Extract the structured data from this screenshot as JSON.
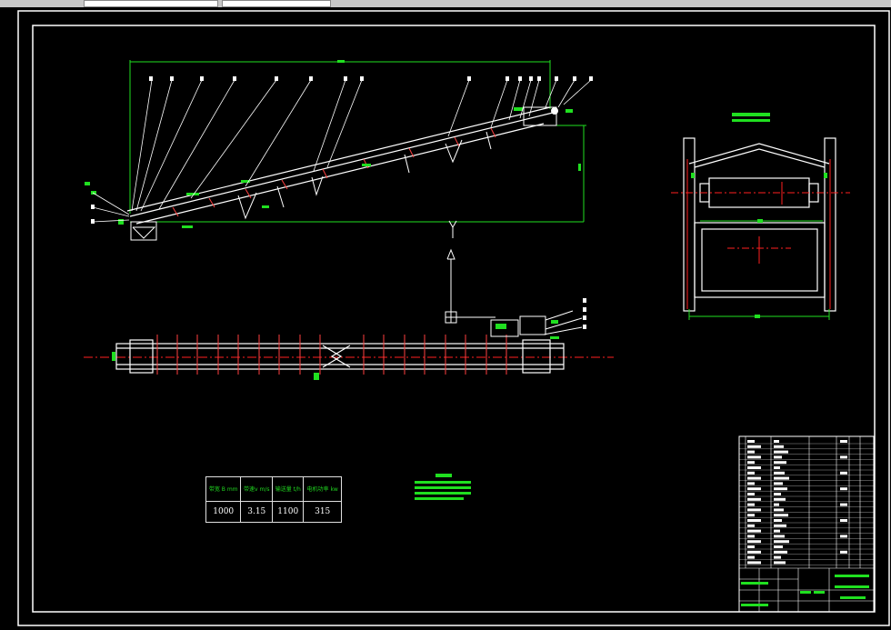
{
  "colors": {
    "background": "#000000",
    "outline": "#ffffff",
    "dimension": "#20e020",
    "centerline": "#ff2020",
    "chrome": "#c8c8c8"
  },
  "params": {
    "headers": [
      "带宽 B mm",
      "带速v m/s",
      "输送量 t/h",
      "电机功率 kw"
    ],
    "values": [
      "1000",
      "3.15",
      "1100",
      "315"
    ]
  },
  "section_mark": "Y"
}
